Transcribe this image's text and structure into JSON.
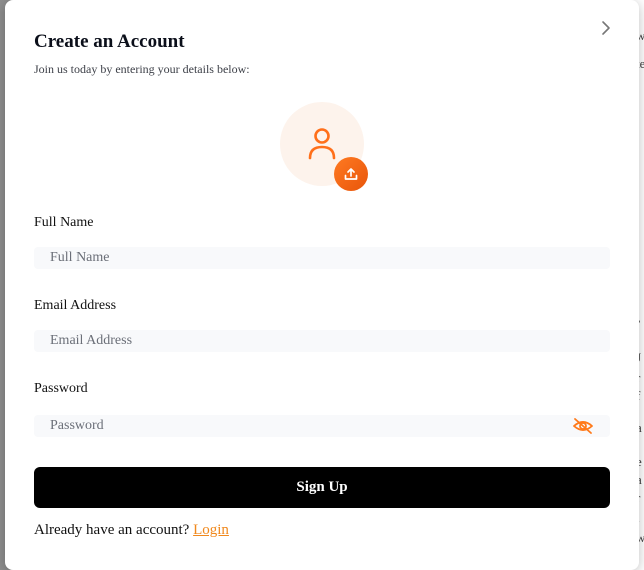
{
  "modal": {
    "title": "Create an Account",
    "subtitle": "Join us today by entering your details below:",
    "close_icon": "close-icon"
  },
  "avatar": {
    "icon": "user-icon",
    "upload_icon": "upload-icon",
    "color": "#ff6f1a"
  },
  "form": {
    "full_name": {
      "label": "Full Name",
      "placeholder": "Full Name",
      "value": ""
    },
    "email": {
      "label": "Email Address",
      "placeholder": "Email Address",
      "value": ""
    },
    "password": {
      "label": "Password",
      "placeholder": "Password",
      "value": "",
      "toggle_icon": "eye-off-icon"
    },
    "submit_label": "Sign Up"
  },
  "footer": {
    "prompt": "Already have an account?",
    "link_label": "Login",
    "link_color": "#f0881c"
  }
}
